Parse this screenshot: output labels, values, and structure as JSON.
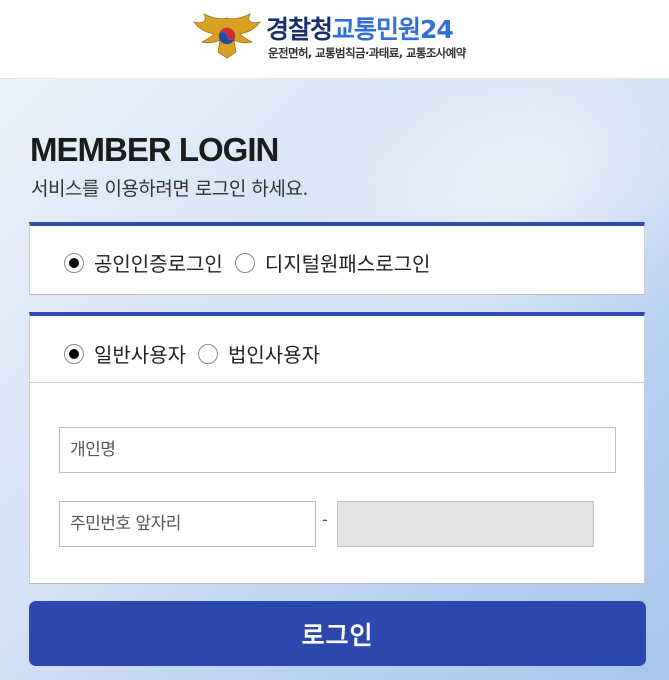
{
  "header": {
    "title_part1": "경찰청",
    "title_part2": "교통민원24",
    "subtitle": "운전면허, 교통범칙금·과태료, 교통조사예약",
    "emblem_icon": "police-eagle-emblem-icon"
  },
  "login": {
    "title": "MEMBER LOGIN",
    "subtitle": "서비스를 이용하려면 로그인 하세요."
  },
  "method": {
    "options": [
      {
        "label": "공인인증로그인",
        "selected": true
      },
      {
        "label": "디지털원패스로그인",
        "selected": false
      }
    ]
  },
  "user_type": {
    "options": [
      {
        "label": "일반사용자",
        "selected": true
      },
      {
        "label": "법인사용자",
        "selected": false
      }
    ]
  },
  "form": {
    "name_placeholder": "개인명",
    "name_value": "",
    "rrn_front_placeholder": "주민번호 앞자리",
    "rrn_front_value": "",
    "separator": "-",
    "rrn_back_value": ""
  },
  "button": {
    "login_label": "로그인"
  },
  "colors": {
    "accent": "#2c47ad",
    "title_dark": "#1a2e6e",
    "title_blue": "#2f6fd6"
  }
}
